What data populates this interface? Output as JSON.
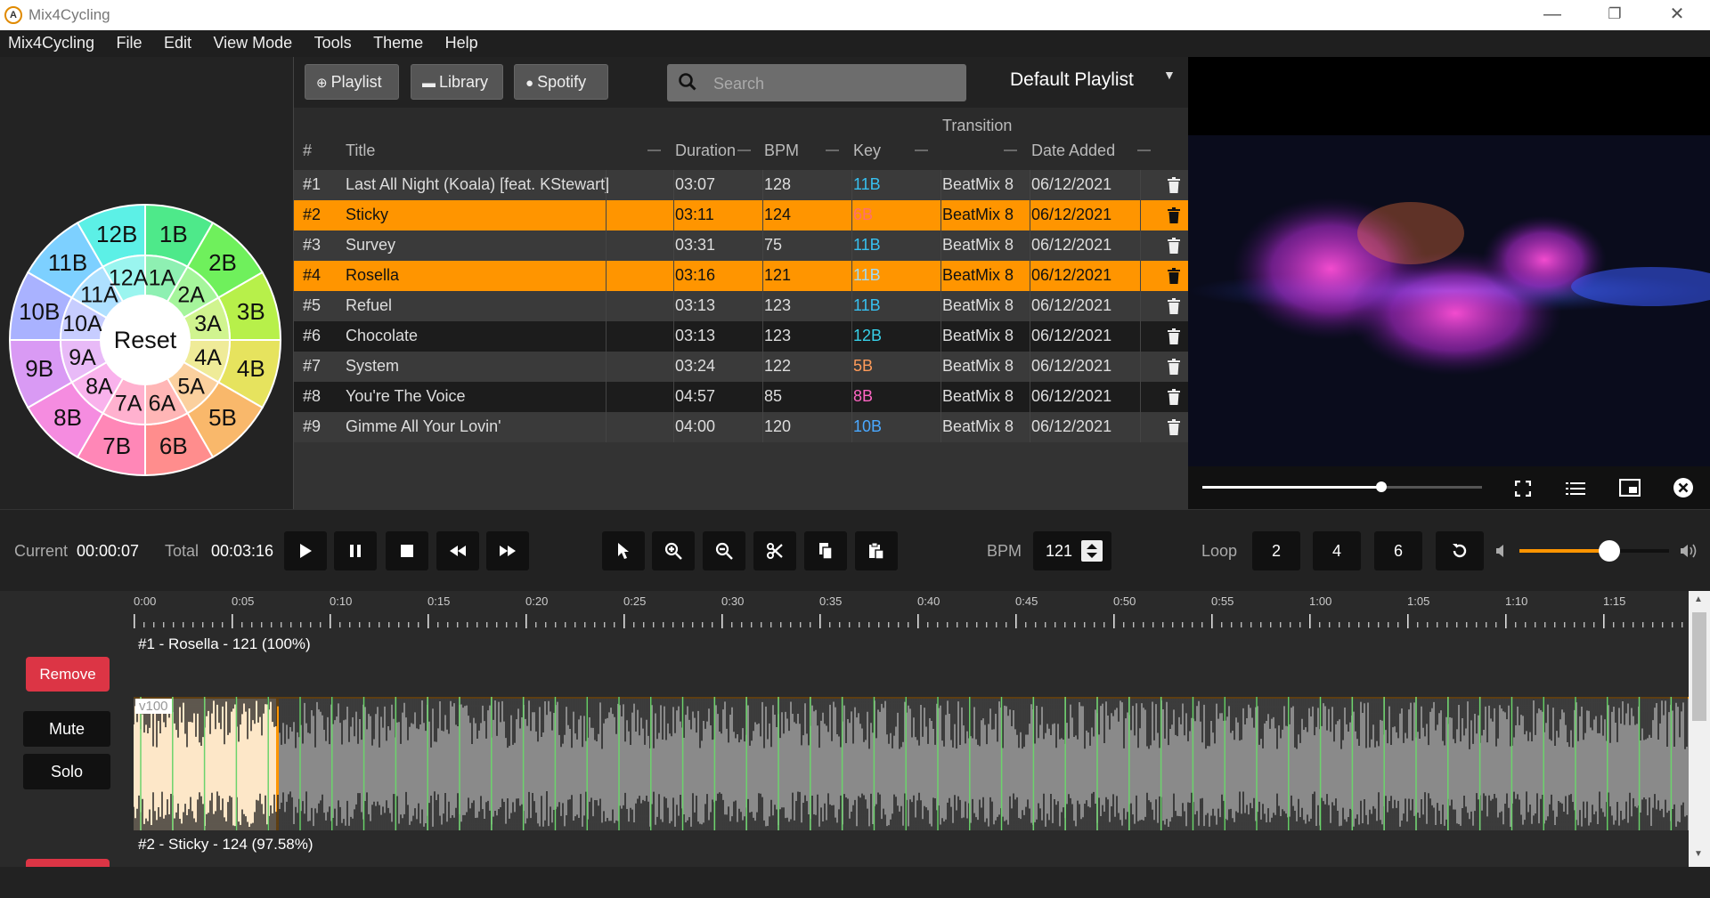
{
  "window": {
    "title": "Mix4Cycling",
    "controls": {
      "minimize": "—",
      "maximize": "❐",
      "close": "✕"
    }
  },
  "menu": [
    "Mix4Cycling",
    "File",
    "Edit",
    "View Mode",
    "Tools",
    "Theme",
    "Help"
  ],
  "camelot_wheel": {
    "center_label": "Reset",
    "outer": [
      "1B",
      "2B",
      "3B",
      "4B",
      "5B",
      "6B",
      "7B",
      "8B",
      "9B",
      "10B",
      "11B",
      "12B"
    ],
    "inner": [
      "1A",
      "2A",
      "3A",
      "4A",
      "5A",
      "6A",
      "7A",
      "8A",
      "9A",
      "10A",
      "11A",
      "12A"
    ]
  },
  "toolbar": {
    "playlist_button": "Playlist",
    "library_button": "Library",
    "spotify_button": "Spotify",
    "search_placeholder": "Search",
    "playlist_select": "Default Playlist"
  },
  "table": {
    "columns": {
      "num": "#",
      "title": "Title",
      "duration": "Duration",
      "bpm": "BPM",
      "key": "Key",
      "transition": "Transition",
      "date": "Date Added"
    },
    "rows": [
      {
        "num": "#1",
        "title": "Last All Night (Koala) [feat. KStewart]",
        "duration": "03:07",
        "bpm": "128",
        "key": "11B",
        "key_color": "#37c0f0",
        "transition": "BeatMix 8",
        "date": "06/12/2021",
        "selected": false
      },
      {
        "num": "#2",
        "title": "Sticky",
        "duration": "03:11",
        "bpm": "124",
        "key": "6B",
        "key_color": "#ff6f6f",
        "transition": "BeatMix 8",
        "date": "06/12/2021",
        "selected": true
      },
      {
        "num": "#3",
        "title": "Survey",
        "duration": "03:31",
        "bpm": "75",
        "key": "11B",
        "key_color": "#37c0f0",
        "transition": "BeatMix 8",
        "date": "06/12/2021",
        "selected": false
      },
      {
        "num": "#4",
        "title": "Rosella",
        "duration": "03:16",
        "bpm": "121",
        "key": "11B",
        "key_color": "#9fdcf7",
        "transition": "BeatMix 8",
        "date": "06/12/2021",
        "selected": true
      },
      {
        "num": "#5",
        "title": "Refuel",
        "duration": "03:13",
        "bpm": "123",
        "key": "11B",
        "key_color": "#37c0f0",
        "transition": "BeatMix 8",
        "date": "06/12/2021",
        "selected": false
      },
      {
        "num": "#6",
        "title": "Chocolate",
        "duration": "03:13",
        "bpm": "123",
        "key": "12B",
        "key_color": "#37d0e8",
        "transition": "BeatMix 8",
        "date": "06/12/2021",
        "selected": false
      },
      {
        "num": "#7",
        "title": "System",
        "duration": "03:24",
        "bpm": "122",
        "key": "5B",
        "key_color": "#ff9b5a",
        "transition": "BeatMix 8",
        "date": "06/12/2021",
        "selected": false
      },
      {
        "num": "#8",
        "title": "You're The Voice",
        "duration": "04:57",
        "bpm": "85",
        "key": "8B",
        "key_color": "#ff66c4",
        "transition": "BeatMix 8",
        "date": "06/12/2021",
        "selected": false
      },
      {
        "num": "#9",
        "title": "Gimme All Your Lovin'",
        "duration": "04:00",
        "bpm": "120",
        "key": "10B",
        "key_color": "#4aa8ff",
        "transition": "BeatMix 8",
        "date": "06/12/2021",
        "selected": false
      }
    ]
  },
  "video": {
    "progress": 0.64
  },
  "transport": {
    "current_label": "Current",
    "current_value": "00:00:07",
    "total_label": "Total",
    "total_value": "00:03:16",
    "bpm_label": "BPM",
    "bpm_value": "121",
    "loop_label": "Loop",
    "loop_options": [
      "2",
      "4",
      "6"
    ],
    "volume": 0.6
  },
  "timeline": {
    "ticks": [
      "0:00",
      "0:05",
      "0:10",
      "0:15",
      "0:20",
      "0:25",
      "0:30",
      "0:35",
      "0:40",
      "0:45",
      "0:50",
      "0:55",
      "1:00",
      "1:05",
      "1:10",
      "1:15"
    ],
    "remove_label": "Remove",
    "mute_label": "Mute",
    "solo_label": "Solo",
    "track1_label": "#1 - Rosella - 121 (100%)",
    "track2_label": "#2 - Sticky - 124 (97.58%)",
    "volume_tag": "v100"
  }
}
